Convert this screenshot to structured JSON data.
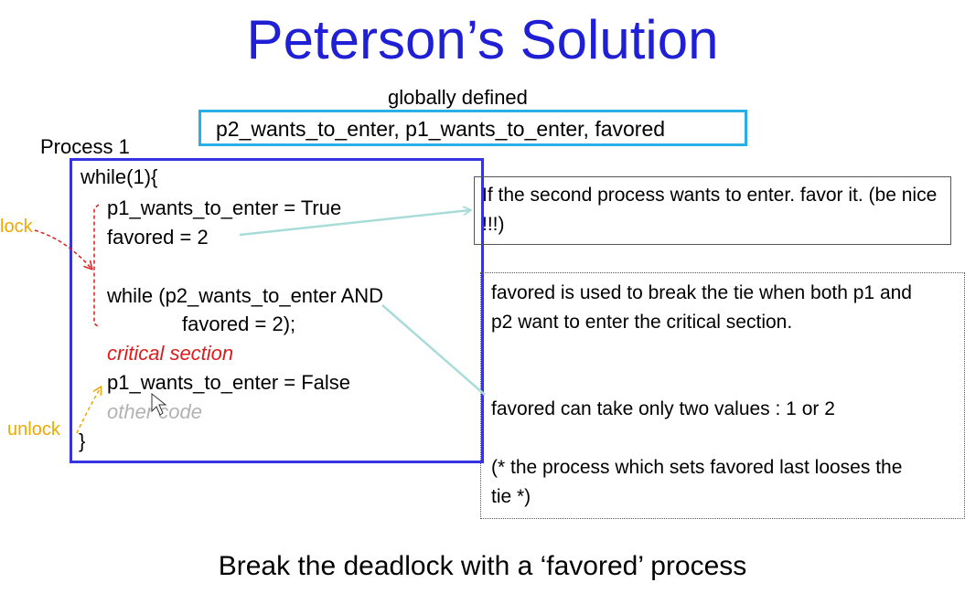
{
  "slide": {
    "title": "Peterson’s Solution",
    "globals_label": "globally defined",
    "globals_text": "p2_wants_to_enter, p1_wants_to_enter, favored",
    "process_label": "Process 1",
    "code": {
      "line1": "while(1){",
      "line2": "p1_wants_to_enter = True",
      "line3": "favored = 2",
      "line4": "while  (p2_wants_to_enter AND",
      "line5": "favored = 2);",
      "critical": "critical section",
      "line7": "p1_wants_to_enter = False",
      "other": "other code",
      "close": "}"
    },
    "lock_label": "lock",
    "unlock_label": "unlock",
    "note1": "If the second process wants to enter. favor it. (be nice !!!)",
    "note2_p1": "favored is used to break the tie when both p1 and p2 want to enter the critical section.",
    "note2_p2": "favored can take only two values : 1 or 2",
    "note2_p3": "(* the process which sets favored last looses the tie *)",
    "footer": "Break the deadlock with a ‘favored’ process"
  },
  "colors": {
    "title": "#1f1fd6",
    "globals_border": "#29aee6",
    "code_border": "#3434e0",
    "critical": "#e01b1b",
    "other_code": "#b2b2b2",
    "lock_label": "#f0a800",
    "arrow_teal": "#a8dcd8"
  }
}
